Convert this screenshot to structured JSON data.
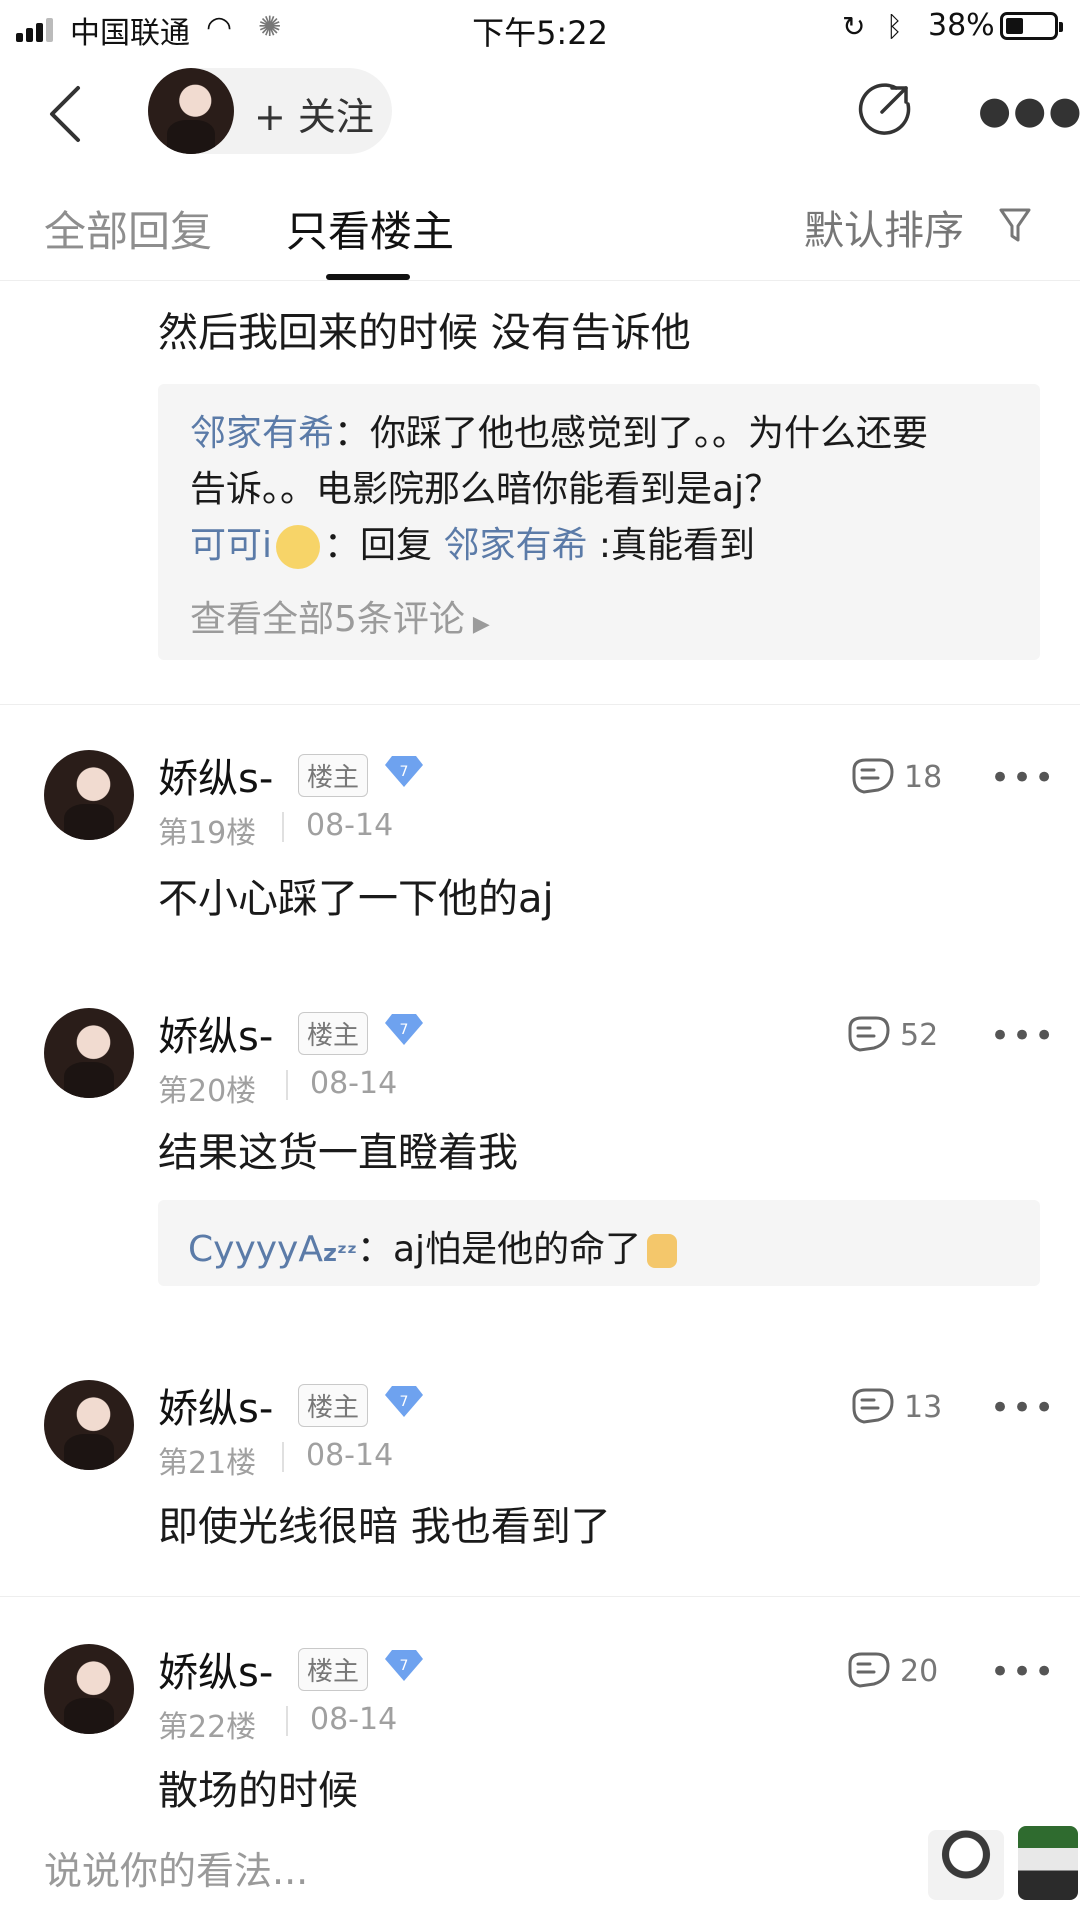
{
  "status_bar": {
    "carrier": "中国联通",
    "time": "下午5:22",
    "battery_percent": "38%",
    "battery_level": 0.38
  },
  "header": {
    "follow_label": "+ 关注"
  },
  "tabs": {
    "all": "全部回复",
    "op_only": "只看楼主",
    "sort": "默认排序"
  },
  "continued_post": {
    "text": "然后我回来的时候 没有告诉他",
    "comments": [
      {
        "user": "邻家有希",
        "sep": "：",
        "text_line1": "你踩了他也感觉到了。。为什么还要",
        "text_line2": "告诉。。电影院那么暗你能看到是aj？"
      },
      {
        "user": "可可i",
        "sep": "：回复 ",
        "reply_to": "邻家有希",
        "text": " :真能看到"
      }
    ],
    "view_all": "查看全部5条评论"
  },
  "posts": [
    {
      "author": "娇纵s-",
      "badge": "楼主",
      "level": "7",
      "floor": "第19楼",
      "date": "08-14",
      "likes": "18",
      "text": "不小心踩了一下他的aj"
    },
    {
      "author": "娇纵s-",
      "badge": "楼主",
      "level": "7",
      "floor": "第20楼",
      "date": "08-14",
      "likes": "52",
      "text": "结果这货一直瞪着我",
      "comment": {
        "user": "CyyyyA",
        "user_suffix": "zᶻᶻ",
        "text": "：aj怕是他的命了"
      }
    },
    {
      "author": "娇纵s-",
      "badge": "楼主",
      "level": "7",
      "floor": "第21楼",
      "date": "08-14",
      "likes": "13",
      "text": "即使光线很暗 我也看到了"
    },
    {
      "author": "娇纵s-",
      "badge": "楼主",
      "level": "7",
      "floor": "第22楼",
      "date": "08-14",
      "likes": "20",
      "text": "散场的时候"
    }
  ],
  "bottom_bar": {
    "input_placeholder": "说说你的看法..."
  },
  "icons": {
    "back": "back-arrow-icon",
    "share": "share-icon",
    "more": "more-icon",
    "filter": "filter-icon",
    "like": "like-icon",
    "level": "diamond-level-icon"
  },
  "colors": {
    "link": "#5b7ba8",
    "muted": "#9b9b9b",
    "level_badge": "#6ea2ef"
  }
}
